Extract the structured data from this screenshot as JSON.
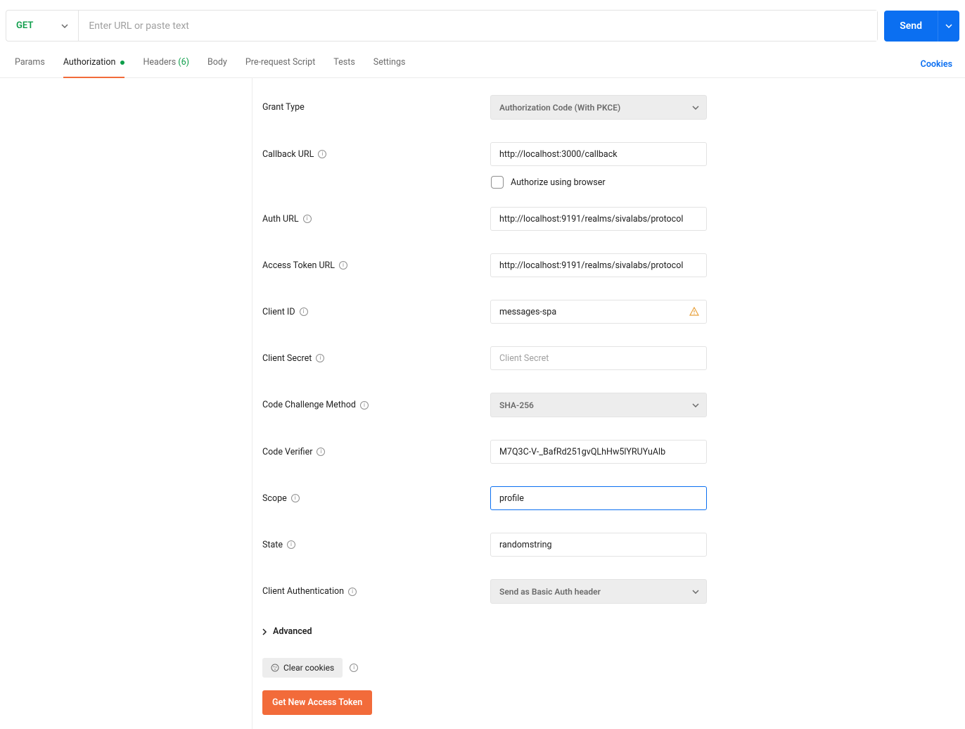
{
  "url_bar": {
    "method": "GET",
    "url_placeholder": "Enter URL or paste text",
    "url_value": "",
    "send_label": "Send"
  },
  "tabs": {
    "params": "Params",
    "authorization": "Authorization",
    "headers": "Headers",
    "headers_count": "(6)",
    "body": "Body",
    "pre_request": "Pre-request Script",
    "tests": "Tests",
    "settings": "Settings",
    "cookies": "Cookies"
  },
  "form": {
    "grant_type_label": "Grant Type",
    "grant_type_value": "Authorization Code (With PKCE)",
    "callback_url_label": "Callback URL",
    "callback_url_value": "http://localhost:3000/callback",
    "authorize_browser_label": "Authorize using browser",
    "auth_url_label": "Auth URL",
    "auth_url_value": "http://localhost:9191/realms/sivalabs/protocol",
    "access_token_url_label": "Access Token URL",
    "access_token_url_value": "http://localhost:9191/realms/sivalabs/protocol",
    "client_id_label": "Client ID",
    "client_id_value": "messages-spa",
    "client_secret_label": "Client Secret",
    "client_secret_placeholder": "Client Secret",
    "client_secret_value": "",
    "code_challenge_label": "Code Challenge Method",
    "code_challenge_value": "SHA-256",
    "code_verifier_label": "Code Verifier",
    "code_verifier_value": "M7Q3C-V-_BafRd251gvQLhHw5lYRUYuAlb",
    "scope_label": "Scope",
    "scope_value": "profile",
    "state_label": "State",
    "state_value": "randomstring",
    "client_auth_label": "Client Authentication",
    "client_auth_value": "Send as Basic Auth header",
    "advanced_label": "Advanced",
    "clear_cookies_label": "Clear cookies",
    "get_token_label": "Get New Access Token"
  }
}
